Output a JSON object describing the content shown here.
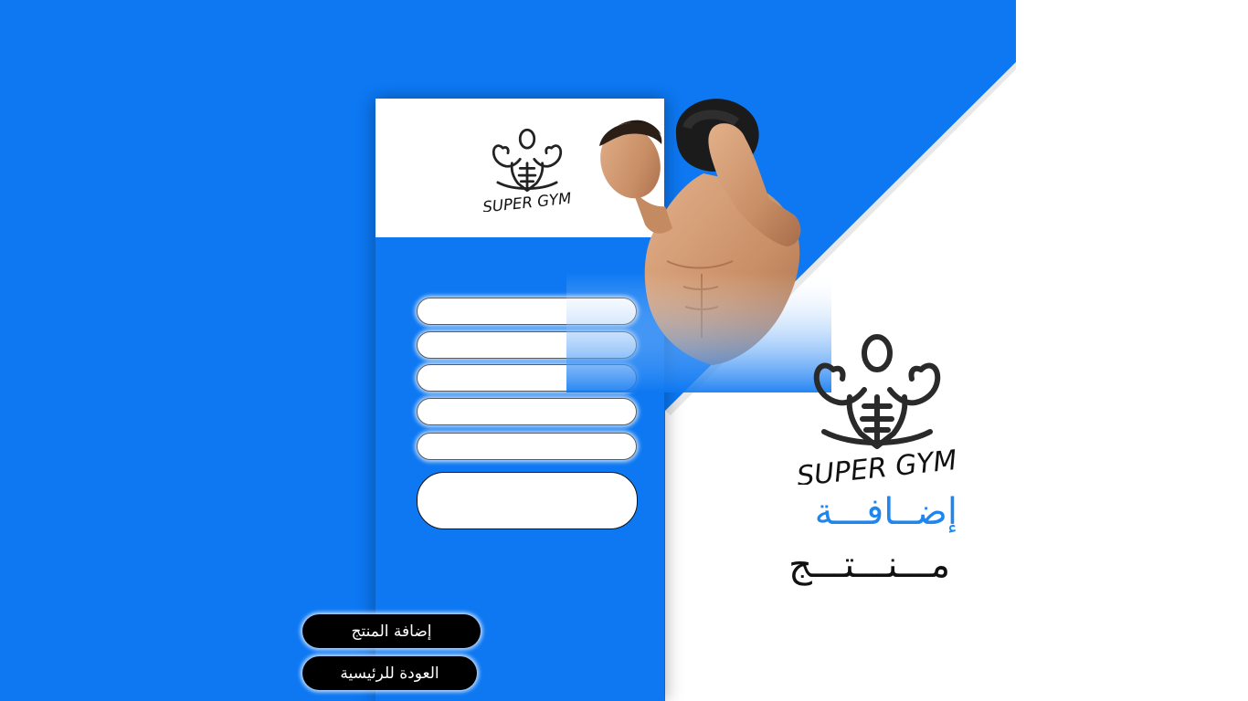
{
  "brand": {
    "name": "SUPER GYM",
    "colors": {
      "primary_blue": "#0d78f2",
      "title_blue": "#1f86ef",
      "button_black": "#000000"
    },
    "logo_icon": "muscle-man-logo"
  },
  "title": {
    "line1": "إضــافـــة",
    "line2": "مـــنـــتـــج"
  },
  "form": {
    "fields": [
      {
        "value": "",
        "placeholder": ""
      },
      {
        "value": "",
        "placeholder": ""
      },
      {
        "value": "",
        "placeholder": ""
      },
      {
        "value": "",
        "placeholder": ""
      },
      {
        "value": "",
        "placeholder": ""
      }
    ],
    "description": {
      "value": "",
      "placeholder": ""
    }
  },
  "actions": {
    "add_product_label": "إضافة المنتج",
    "back_home_label": "العودة للرئيسية"
  }
}
